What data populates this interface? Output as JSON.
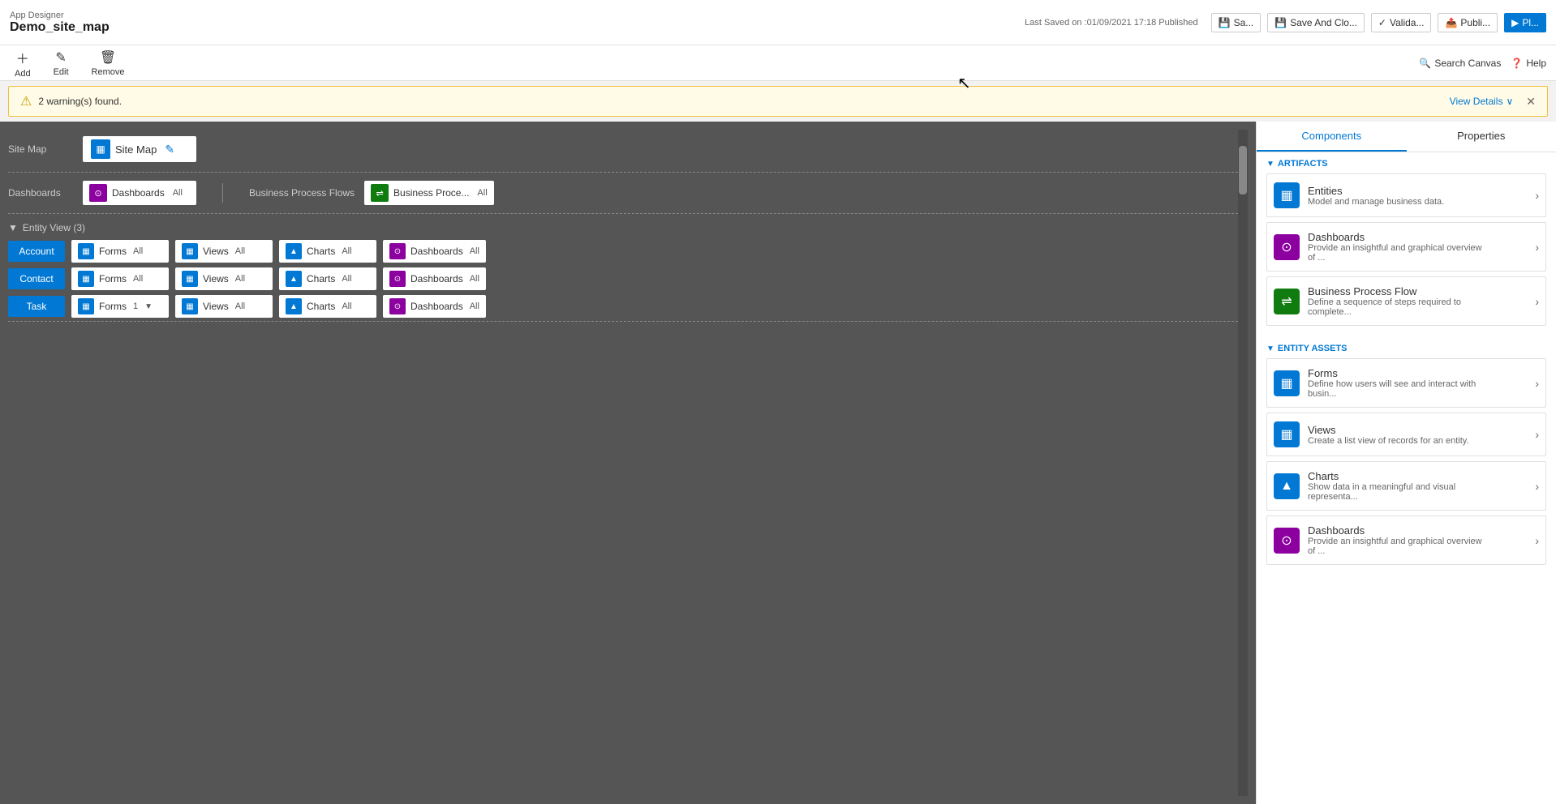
{
  "app": {
    "designer_label": "App Designer",
    "app_name": "Demo_site_map",
    "last_saved": "Last Saved on :01/09/2021 17:18 Published"
  },
  "toolbar": {
    "add_label": "Add",
    "edit_label": "Edit",
    "remove_label": "Remove",
    "search_canvas_label": "Search Canvas",
    "help_label": "Help"
  },
  "header_buttons": {
    "save_label": "Sa...",
    "save_and_close_label": "Save And Clo...",
    "validate_label": "Valida...",
    "publish_label": "Publi...",
    "play_label": "Pl..."
  },
  "warning": {
    "message": "2 warning(s) found.",
    "view_details_label": "View Details"
  },
  "canvas": {
    "site_map_row": {
      "label": "Site Map",
      "card_label": "Site Map"
    },
    "dashboard_row": {
      "label": "Dashboards",
      "dashboards_card": "Dashboards",
      "dashboards_badge": "All",
      "bpf_label": "Business Process Flows",
      "bpf_card": "Business Proce...",
      "bpf_badge": "All"
    },
    "entity_view": {
      "header": "Entity View (3)",
      "entities": [
        {
          "name": "Account",
          "forms_label": "Forms",
          "forms_badge": "All",
          "views_label": "Views",
          "views_badge": "All",
          "charts_label": "Charts",
          "charts_badge": "All",
          "dashboards_label": "Dashboards",
          "dashboards_badge": "All"
        },
        {
          "name": "Contact",
          "forms_label": "Forms",
          "forms_badge": "All",
          "views_label": "Views",
          "views_badge": "All",
          "charts_label": "Charts",
          "charts_badge": "All",
          "dashboards_label": "Dashboards",
          "dashboards_badge": "All"
        },
        {
          "name": "Task",
          "forms_label": "Forms",
          "forms_badge": "1",
          "forms_has_dropdown": true,
          "views_label": "Views",
          "views_badge": "All",
          "charts_label": "Charts",
          "charts_badge": "All",
          "dashboards_label": "Dashboards",
          "dashboards_badge": "All"
        }
      ]
    }
  },
  "right_panel": {
    "components_tab": "Components",
    "properties_tab": "Properties",
    "artifacts_section": "ARTIFACTS",
    "entity_assets_section": "ENTITY ASSETS",
    "components": [
      {
        "id": "entities",
        "title": "Entities",
        "description": "Model and manage business data.",
        "icon_type": "ci-blue",
        "icon_char": "▦"
      },
      {
        "id": "dashboards",
        "title": "Dashboards",
        "description": "Provide an insightful and graphical overview of ...",
        "icon_type": "ci-purple",
        "icon_char": "⊙"
      },
      {
        "id": "bpf",
        "title": "Business Process Flow",
        "description": "Define a sequence of steps required to complete...",
        "icon_type": "ci-green",
        "icon_char": "⇌"
      }
    ],
    "entity_assets": [
      {
        "id": "forms",
        "title": "Forms",
        "description": "Define how users will see and interact with busin...",
        "icon_type": "ci-blue",
        "icon_char": "▦"
      },
      {
        "id": "views",
        "title": "Views",
        "description": "Create a list view of records for an entity.",
        "icon_type": "ci-blue",
        "icon_char": "▦"
      },
      {
        "id": "charts",
        "title": "Charts",
        "description": "Show data in a meaningful and visual representa...",
        "icon_type": "ci-chart",
        "icon_char": "▲"
      },
      {
        "id": "dashboards2",
        "title": "Dashboards",
        "description": "Provide an insightful and graphical overview of ...",
        "icon_type": "ci-dash",
        "icon_char": "⊙"
      }
    ]
  }
}
